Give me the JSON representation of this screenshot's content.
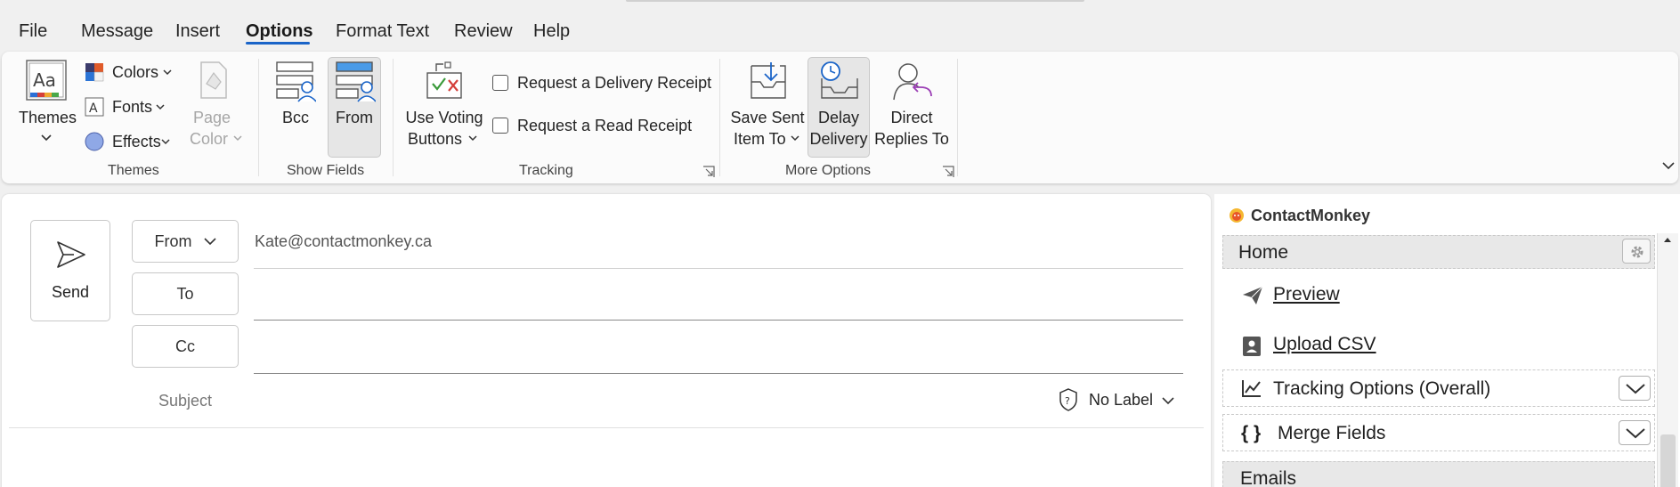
{
  "menu": {
    "items": [
      "File",
      "Message",
      "Insert",
      "Options",
      "Format Text",
      "Review",
      "Help"
    ],
    "active": "Options"
  },
  "ribbon": {
    "themes_group": {
      "themes_label": "Themes",
      "colors_label": "Colors",
      "fonts_label": "Fonts",
      "effects_label": "Effects",
      "page_color_line1": "Page",
      "page_color_line2": "Color",
      "group_label": "Themes"
    },
    "show_fields_group": {
      "bcc_label": "Bcc",
      "from_label": "From",
      "group_label": "Show Fields"
    },
    "tracking_group": {
      "voting_line1": "Use Voting",
      "voting_line2": "Buttons",
      "delivery_receipt": "Request a Delivery Receipt",
      "read_receipt": "Request a Read Receipt",
      "group_label": "Tracking"
    },
    "more_options_group": {
      "save_sent_line1": "Save Sent",
      "save_sent_line2": "Item To",
      "delay_line1": "Delay",
      "delay_line2": "Delivery",
      "direct_line1": "Direct",
      "direct_line2": "Replies To",
      "group_label": "More Options"
    }
  },
  "compose": {
    "send_label": "Send",
    "from_button": "From",
    "from_value": "Kate@contactmonkey.ca",
    "to_button": "To",
    "cc_button": "Cc",
    "subject_label": "Subject",
    "sensitivity_label": "No Label"
  },
  "addin": {
    "title": "ContactMonkey",
    "home_label": "Home",
    "preview_label": "Preview",
    "upload_label": "Upload CSV",
    "tracking_label": "Tracking Options (Overall)",
    "merge_label": "Merge Fields",
    "merge_icon": "{ }",
    "emails_label": "Emails"
  },
  "colors": {
    "accent": "#1a64c8",
    "ribbon_bg": "#fbfbfb",
    "window_bg": "#f0f0f0"
  }
}
